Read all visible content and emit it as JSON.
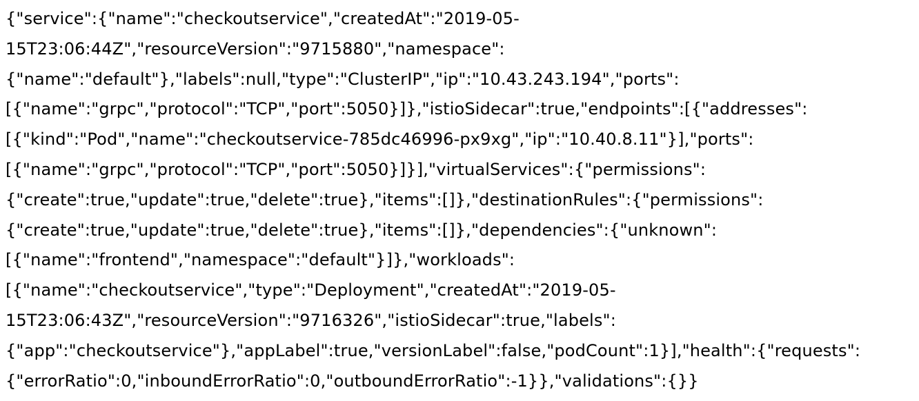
{
  "document": {
    "lines": [
      "{\"service\":{\"name\":\"checkoutservice\",\"createdAt\":\"2019-05-",
      "15T23:06:44Z\",\"resourceVersion\":\"9715880\",\"namespace\":",
      "{\"name\":\"default\"},\"labels\":null,\"type\":\"ClusterIP\",\"ip\":\"10.43.243.194\",\"ports\":",
      "[{\"name\":\"grpc\",\"protocol\":\"TCP\",\"port\":5050}]},\"istioSidecar\":true,\"endpoints\":[{\"addresses\":",
      "[{\"kind\":\"Pod\",\"name\":\"checkoutservice-785dc46996-px9xg\",\"ip\":\"10.40.8.11\"}],\"ports\":",
      "[{\"name\":\"grpc\",\"protocol\":\"TCP\",\"port\":5050}]}],\"virtualServices\":{\"permissions\":",
      "{\"create\":true,\"update\":true,\"delete\":true},\"items\":[]},\"destinationRules\":{\"permissions\":",
      "{\"create\":true,\"update\":true,\"delete\":true},\"items\":[]},\"dependencies\":{\"unknown\":",
      "[{\"name\":\"frontend\",\"namespace\":\"default\"}]},\"workloads\":",
      "[{\"name\":\"checkoutservice\",\"type\":\"Deployment\",\"createdAt\":\"2019-05-",
      "15T23:06:43Z\",\"resourceVersion\":\"9716326\",\"istioSidecar\":true,\"labels\":",
      "{\"app\":\"checkoutservice\"},\"appLabel\":true,\"versionLabel\":false,\"podCount\":1}],\"health\":{\"requests\":",
      "{\"errorRatio\":0,\"inboundErrorRatio\":0,\"outboundErrorRatio\":-1}},\"validations\":{}}"
    ]
  }
}
